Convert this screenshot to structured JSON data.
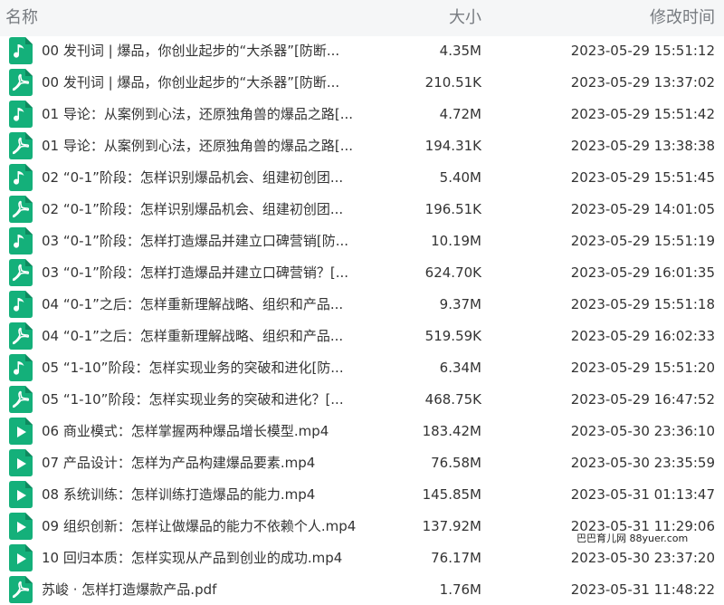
{
  "header": {
    "name": "名称",
    "size": "大小",
    "time": "修改时间"
  },
  "colors": {
    "icon_green": "#14b07a"
  },
  "files": [
    {
      "icon": "audio-file-icon",
      "name": "00 发刊词 | 爆品，你创业起步的“大杀器”[防断...",
      "size": "4.35M",
      "time": "2023-05-29 15:51:12"
    },
    {
      "icon": "pdf-file-icon",
      "name": "00 发刊词 | 爆品，你创业起步的“大杀器”[防断...",
      "size": "210.51K",
      "time": "2023-05-29 13:37:02"
    },
    {
      "icon": "audio-file-icon",
      "name": "01 导论：从案例到心法，还原独角兽的爆品之路[...",
      "size": "4.72M",
      "time": "2023-05-29 15:51:42"
    },
    {
      "icon": "pdf-file-icon",
      "name": "01 导论：从案例到心法，还原独角兽的爆品之路[...",
      "size": "194.31K",
      "time": "2023-05-29 13:38:38"
    },
    {
      "icon": "audio-file-icon",
      "name": "02 “0-1”阶段：怎样识别爆品机会、组建初创团...",
      "size": "5.40M",
      "time": "2023-05-29 15:51:45"
    },
    {
      "icon": "pdf-file-icon",
      "name": "02 “0-1”阶段：怎样识别爆品机会、组建初创团...",
      "size": "196.51K",
      "time": "2023-05-29 14:01:05"
    },
    {
      "icon": "audio-file-icon",
      "name": "03 “0-1”阶段：怎样打造爆品并建立口碑营销[防...",
      "size": "10.19M",
      "time": "2023-05-29 15:51:19"
    },
    {
      "icon": "pdf-file-icon",
      "name": "03 “0-1”阶段：怎样打造爆品并建立口碑营销？[...",
      "size": "624.70K",
      "time": "2023-05-29 16:01:35"
    },
    {
      "icon": "audio-file-icon",
      "name": "04 “0-1”之后：怎样重新理解战略、组织和产品...",
      "size": "9.37M",
      "time": "2023-05-29 15:51:18"
    },
    {
      "icon": "pdf-file-icon",
      "name": "04 “0-1”之后：怎样重新理解战略、组织和产品...",
      "size": "519.59K",
      "time": "2023-05-29 16:02:33"
    },
    {
      "icon": "audio-file-icon",
      "name": "05 “1-10”阶段：怎样实现业务的突破和进化[防...",
      "size": "6.34M",
      "time": "2023-05-29 15:51:20"
    },
    {
      "icon": "pdf-file-icon",
      "name": "05 “1-10”阶段：怎样实现业务的突破和进化？[...",
      "size": "468.75K",
      "time": "2023-05-29 16:47:52"
    },
    {
      "icon": "video-file-icon",
      "name": "06 商业模式：怎样掌握两种爆品增长模型.mp4",
      "size": "183.42M",
      "time": "2023-05-30 23:36:10"
    },
    {
      "icon": "video-file-icon",
      "name": "07 产品设计：怎样为产品构建爆品要素.mp4",
      "size": "76.58M",
      "time": "2023-05-30 23:35:59"
    },
    {
      "icon": "video-file-icon",
      "name": "08 系统训练：怎样训练打造爆品的能力.mp4",
      "size": "145.85M",
      "time": "2023-05-31 01:13:47"
    },
    {
      "icon": "video-file-icon",
      "name": "09 组织创新：怎样让做爆品的能力不依赖个人.mp4",
      "size": "137.92M",
      "time": "2023-05-31 11:29:06"
    },
    {
      "icon": "video-file-icon",
      "name": "10 回归本质：怎样实现从产品到创业的成功.mp4",
      "size": "76.17M",
      "time": "2023-05-30 23:37:20"
    },
    {
      "icon": "pdf-file-icon",
      "name": "苏峻 · 怎样打造爆款产品.pdf",
      "size": "1.76M",
      "time": "2023-05-31 11:48:22"
    }
  ],
  "watermark": "巴巴育儿网 88yuer.com"
}
